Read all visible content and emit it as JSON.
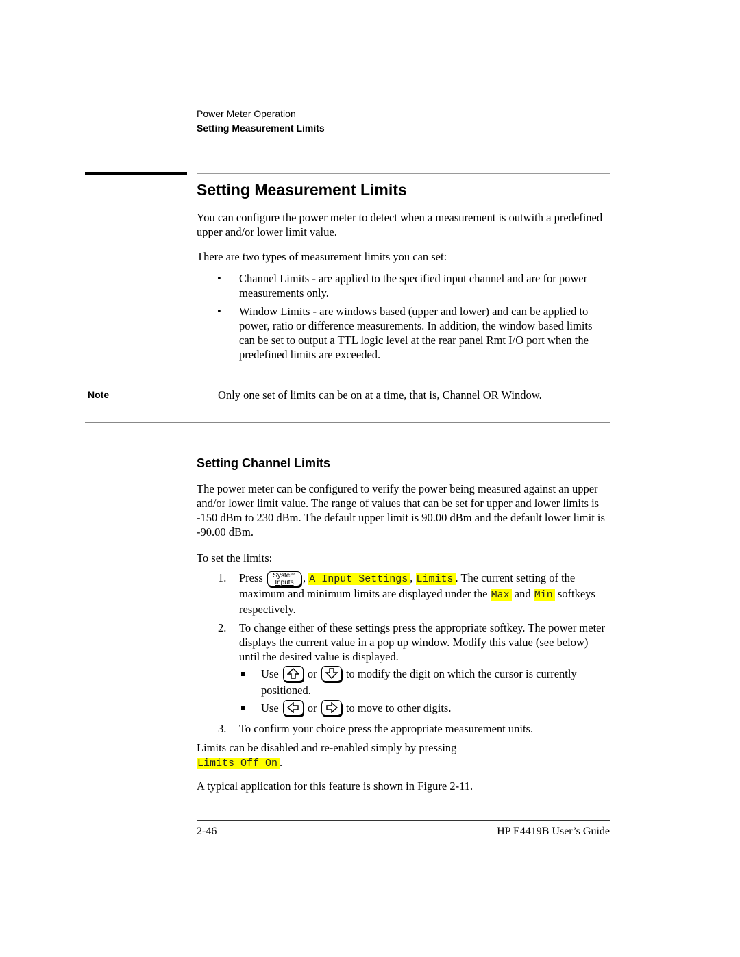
{
  "running_head": {
    "chapter": "Power Meter Operation",
    "section": "Setting Measurement Limits"
  },
  "heading": "Setting Measurement Limits",
  "intro": {
    "p1": "You can configure the power meter to detect when a measurement is outwith a predefined upper and/or lower limit value.",
    "p2": "There are two types of measurement limits you can set:"
  },
  "bullets": [
    {
      "marker": "•",
      "text": "Channel Limits - are applied to the specified input channel and are for power measurements only."
    },
    {
      "marker": "•",
      "text": "Window Limits - are windows based (upper and lower) and can be applied to power, ratio or difference measurements. In addition, the window based limits can be set to output a TTL logic level at the rear panel Rmt I/O port when the predefined limits are exceeded."
    }
  ],
  "note": {
    "label": "Note",
    "text": "Only one set of limits can be on at a time, that is, Channel OR Window."
  },
  "subheading": "Setting Channel Limits",
  "channel": {
    "p1": "The power meter can be configured to verify the power being measured against an upper and/or lower limit value. The range of values that can be set for upper and lower limits is -150 dBm to 230 dBm. The default upper limit is 90.00 dBm and the default lower limit is -90.00 dBm.",
    "p2": "To set the limits:"
  },
  "steps": {
    "s1": {
      "num": "1.",
      "press": "Press",
      "key_top": "System",
      "key_bottom": "Inputs",
      "comma1": ",",
      "softkey1": "A Input Settings",
      "comma2": ",",
      "softkey2": "Limits",
      "text1": ". The current setting of the maximum and minimum limits are displayed under the",
      "softkey3": "Max",
      "and": "and",
      "softkey4": "Min",
      "text2": "softkeys respectively."
    },
    "s2": {
      "num": "2.",
      "text": "To change either of these settings press the appropriate softkey. The power meter displays the current value in a pop up window. Modify this value (see below) until the desired value is displayed.",
      "sub": [
        {
          "use": "Use",
          "key_a": "up-arrow-key",
          "or": "or",
          "key_b": "down-arrow-key",
          "text": "to modify the digit on which the cursor is currently positioned."
        },
        {
          "use": "Use",
          "key_a": "left-arrow-key",
          "or": "or",
          "key_b": "right-arrow-key",
          "text": "to move to other digits."
        }
      ]
    },
    "s3": {
      "num": "3.",
      "text": "To confirm your choice press the appropriate measurement units."
    }
  },
  "disable": {
    "text": "Limits can be disabled and re-enabled simply by pressing",
    "softkey": "Limits Off On",
    "period": "."
  },
  "figure_ref": "A typical application for this feature is shown in Figure 2-11.",
  "footer": {
    "page": "2-46",
    "guide": "HP E4419B User’s Guide"
  }
}
